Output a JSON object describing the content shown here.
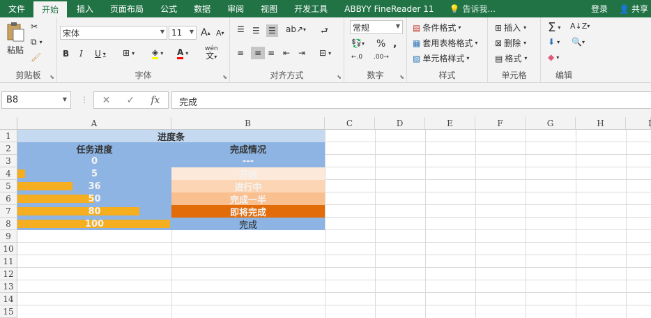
{
  "ribbon_tabs": [
    "文件",
    "开始",
    "插入",
    "页面布局",
    "公式",
    "数据",
    "审阅",
    "视图",
    "开发工具",
    "ABBYY FineReader 11"
  ],
  "tell_me": "告诉我...",
  "login": "登录",
  "share": "共享",
  "clipboard": {
    "paste": "粘贴",
    "label": "剪贴板"
  },
  "font": {
    "name": "宋体",
    "size": "11",
    "label": "字体",
    "phonetic": "wén"
  },
  "alignment": {
    "label": "对齐方式"
  },
  "number": {
    "format": "常规",
    "label": "数字"
  },
  "styles": {
    "conditional": "条件格式",
    "table": "套用表格格式",
    "cell_styles": "单元格样式",
    "label": "样式"
  },
  "cells": {
    "insert": "插入",
    "delete": "删除",
    "format": "格式",
    "label": "单元格"
  },
  "editing": {
    "label": "编辑"
  },
  "formula_bar": {
    "name_box": "B8",
    "value": "完成"
  },
  "columns": [
    "A",
    "B",
    "C",
    "D",
    "E",
    "F",
    "G",
    "H",
    "I"
  ],
  "rows": [
    "1",
    "2",
    "3",
    "4",
    "5",
    "6",
    "7",
    "8",
    "9",
    "10",
    "11",
    "12",
    "13",
    "14",
    "15"
  ],
  "sheet": {
    "title": "进度条",
    "header_a": "任务进度",
    "header_b": "完成情况",
    "progress": [
      {
        "value": "0",
        "status": "---",
        "fill": 0
      },
      {
        "value": "5",
        "status": "开始",
        "fill": 0.05
      },
      {
        "value": "36",
        "status": "进行中",
        "fill": 0.36
      },
      {
        "value": "50",
        "status": "完成一半",
        "fill": 0.5
      },
      {
        "value": "80",
        "status": "即将完成",
        "fill": 0.8
      },
      {
        "value": "100",
        "status": "完成",
        "fill": 1.0
      }
    ]
  },
  "colors": {
    "ribbon_green": "#217346",
    "header_fill": "#c5d9f1",
    "column_a_fill": "#8db4e2",
    "bar_orange": "#f4ae1f",
    "status_fills": [
      "#8db4e2",
      "#fde9d9",
      "#fcd5b4",
      "#fabf8f",
      "#e26b0a",
      "#8db4e2"
    ]
  }
}
